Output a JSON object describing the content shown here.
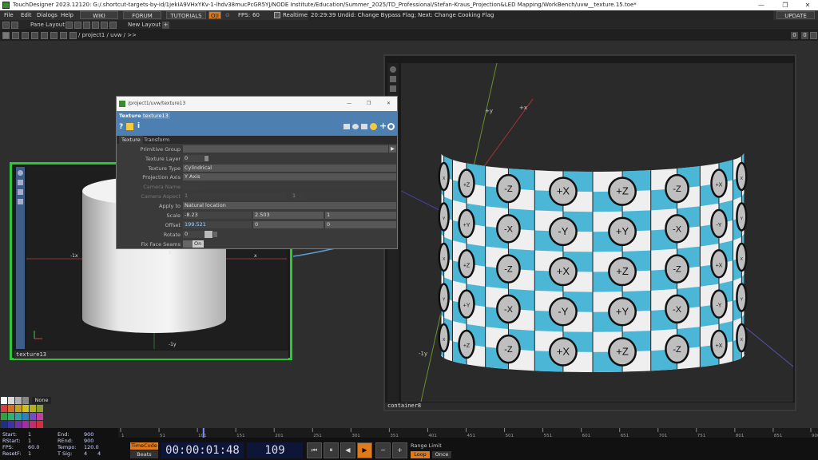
{
  "window": {
    "title": "TouchDesigner 2023.12120: G:/.shortcut-targets-by-id/1jekIA9VHxYKv-1-lhdv38mucPcGR5YJ/NODE Institute/Education/Summer_2025/TD_Professional/Stefan-Kraus_Projection&LED Mapping/WorkBench/uvw__texture.15.toe*",
    "minimize": "—",
    "maximize": "❐",
    "close": "✕"
  },
  "menu": {
    "items": [
      "File",
      "Edit",
      "Dialogs",
      "Help"
    ],
    "wiki": "WIKI",
    "forum": "FORUM",
    "tutorials": "TUTORIALS",
    "oi": "O|I",
    "fps_label": "FPS:",
    "fps_value": "60",
    "realtime": "Realtime",
    "status": "20:29:39 Undid: Change Bypass Flag; Next: Change Cooking Flag",
    "update": "UPDATE"
  },
  "toolbar": {
    "pane_layout": "Pane Layout",
    "new_layout": "New Layout",
    "plus": "+",
    "path": "/ project1 / uvw / >>",
    "right_btn_1": "0",
    "right_btn_2": "0"
  },
  "param_window": {
    "title": "/project1/uvw/texture13",
    "op_type": "Texture",
    "op_name": "texture13",
    "tabs": [
      "Texture",
      "Transform"
    ],
    "params": {
      "primitive_group": {
        "label": "Primitive Group",
        "value": ""
      },
      "texture_layer": {
        "label": "Texture Layer",
        "value": "0"
      },
      "texture_type": {
        "label": "Texture Type",
        "value": "Cylindrical"
      },
      "projection_axis": {
        "label": "Projection Axis",
        "value": "Y Axis"
      },
      "camera_name": {
        "label": "Camera Name",
        "value": ""
      },
      "camera_aspect": {
        "label": "Camera Aspect",
        "value": "1",
        "value2": "1"
      },
      "apply_to": {
        "label": "Apply to",
        "value": "Natural location"
      },
      "scale": {
        "label": "Scale",
        "x": "-8.23",
        "y": "2.503",
        "z": "1"
      },
      "offset": {
        "label": "Offset",
        "x": "199.521",
        "y": "0",
        "z": "0"
      },
      "rotate": {
        "label": "Rotate",
        "value": "0"
      },
      "fix_face_seams": {
        "label": "Fix Face Seams",
        "value": "On"
      }
    }
  },
  "left_node": {
    "name": "texture13",
    "axis_z": "z",
    "axis_x": "x",
    "axis_neg_x": "-1x",
    "axis_neg_y": "-1y"
  },
  "right_node": {
    "name": "container8",
    "axis_y": "+y",
    "axis_x": "+x",
    "axis_neg_y": "-1y",
    "row_labels": [
      [
        "X",
        "+Z",
        "-Z",
        "+X",
        "+Z",
        "-Z",
        "+X",
        "X"
      ],
      [
        "Y",
        "+Y",
        "-X",
        "-Y",
        "+Y",
        "-X",
        "-Y",
        "Y"
      ],
      [
        "X",
        "+Z",
        "-Z",
        "+X",
        "+Z",
        "-Z",
        "+X",
        "X"
      ],
      [
        "Y",
        "+Y",
        "-X",
        "-Y",
        "+Y",
        "-X",
        "-Y",
        "Y"
      ],
      [
        "X",
        "+Z",
        "-Z",
        "+X",
        "+Z",
        "-Z",
        "+X",
        "X"
      ]
    ],
    "checker_color": "#4bb6d6"
  },
  "palette": {
    "none_label": "None"
  },
  "timeline": {
    "start_label": "Start:",
    "start_value": "1",
    "rstart_label": "RStart:",
    "rstart_value": "1",
    "fps_label": "FPS:",
    "fps_value": "60.0",
    "resetf_label": "ResetF:",
    "resetf_value": "1",
    "end_label": "End:",
    "end_value": "900",
    "rend_label": "REnd:",
    "rend_value": "900",
    "tempo_label": "Tempo:",
    "tempo_value": "120.0",
    "tsig_label": "T Sig:",
    "tsig_a": "4",
    "tsig_b": "4",
    "ticks": [
      "1",
      "51",
      "101",
      "151",
      "201",
      "251",
      "301",
      "351",
      "401",
      "451",
      "501",
      "551",
      "601",
      "651",
      "701",
      "751",
      "801",
      "851",
      "900"
    ],
    "timecode_btn": "TimeCode",
    "beats_btn": "Beats",
    "timecode": "00:00:01:48",
    "frame": "109",
    "range_limit": "Range Limit",
    "loop": "Loop",
    "once": "Once",
    "accent": "#e07b1c"
  }
}
